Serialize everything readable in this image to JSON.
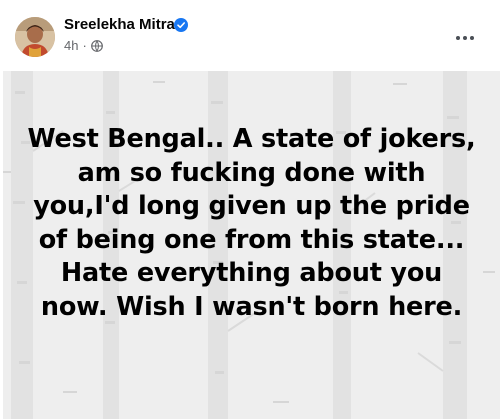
{
  "post": {
    "author": {
      "name": "Sreelekha Mitra",
      "verified": true
    },
    "timestamp": "4h",
    "meta_separator": "·",
    "audience_icon": "globe-icon",
    "more_icon": "more-horizontal-icon",
    "body_lines": [
      "West Bengal.. A state of jokers,",
      "am so fucking done with",
      "you,I'd long given up the pride",
      "of being one from this state...",
      "Hate everything about you",
      "now. Wish I wasn't born here."
    ]
  },
  "colors": {
    "background_panel": "#eeeeee",
    "text": "#000000",
    "name": "#050505",
    "meta": "#65676b",
    "verified_badge": "#1877f2"
  }
}
